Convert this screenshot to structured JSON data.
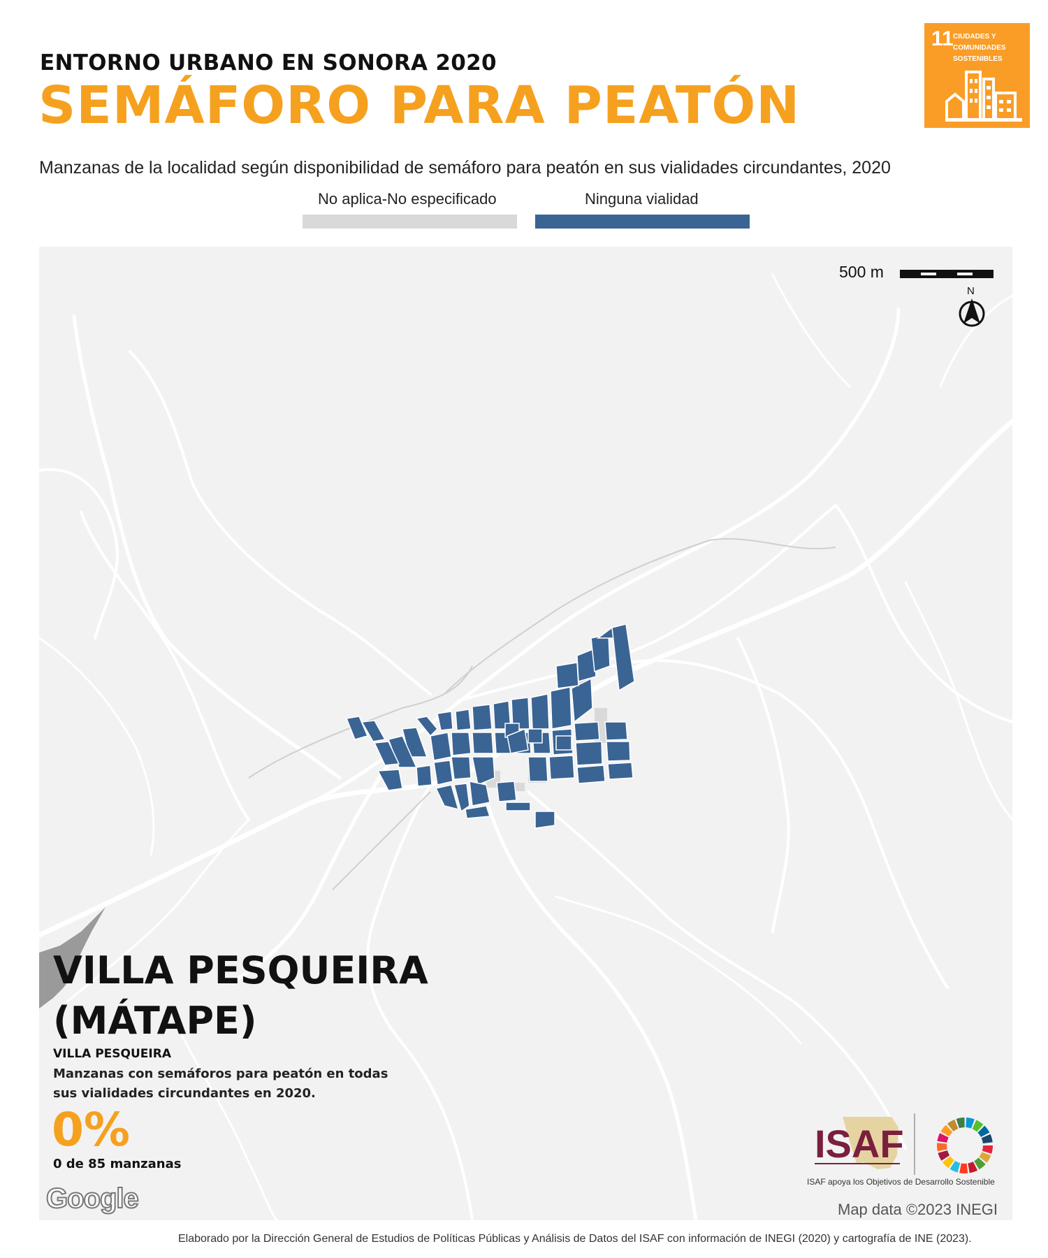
{
  "header": {
    "kicker": "ENTORNO URBANO EN SONORA 2020",
    "title": "SEMÁFORO PARA PEATÓN",
    "subtitle": "Manzanas de la localidad según disponibilidad de semáforo para peatón en sus vialidades circundantes, 2020"
  },
  "legend": {
    "items": [
      {
        "label": "No aplica-No especificado",
        "color": "#d9d9d9"
      },
      {
        "label": "Ninguna vialidad",
        "color": "#3a6494"
      }
    ]
  },
  "sdg_badge": {
    "number": "11",
    "text": "CIUDADES Y COMUNIDADES SOSTENIBLES",
    "color": "#f99d26"
  },
  "map": {
    "scale_label": "500 m",
    "north_label": "N",
    "place_name_line1": "VILLA PESQUEIRA",
    "place_name_line2": "(MÁTAPE)",
    "municipality": "VILLA PESQUEIRA",
    "stat_description": "Manzanas con semáforos para peatón en todas sus vialidades circundantes en 2020.",
    "stat_percent": "0%",
    "stat_count": "0 de 85 manzanas",
    "google_logo": "Google",
    "map_data": "Map data ©2023 INEGI",
    "background_color": "#f2f2f2",
    "block_color": "#3a6494",
    "na_color": "#d9d9d9"
  },
  "isaf": {
    "logo_text": "ISAF",
    "tagline": "ISAF apoya los Objetivos de Desarrollo Sostenible"
  },
  "credits": "Elaborado por la Dirección General de Estudios de Políticas Públicas y Análisis de Datos del ISAF con información de INEGI (2020) y cartografía de INE (2023)."
}
